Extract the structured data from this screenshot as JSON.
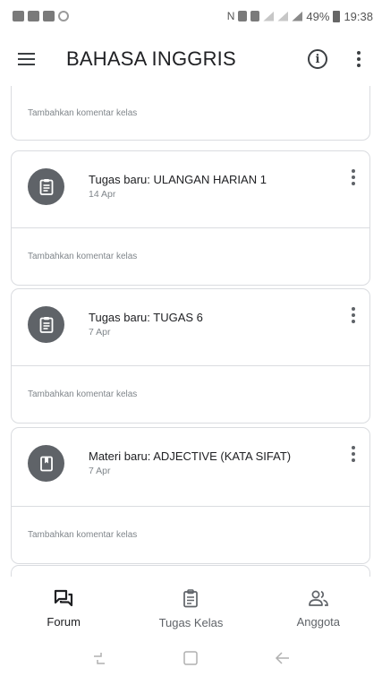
{
  "status_bar": {
    "battery": "49%",
    "time": "19:38"
  },
  "app_bar": {
    "title": "BAHASA INGGRIS",
    "info_icon": "info-icon",
    "more_icon": "more-vert-icon",
    "menu_icon": "menu-icon"
  },
  "stream": {
    "top_card": {
      "comment_placeholder": "Tambahkan komentar kelas"
    },
    "posts": [
      {
        "icon": "assignment-icon",
        "title": "Tugas baru: ULANGAN HARIAN 1",
        "date": "14 Apr",
        "comment_placeholder": "Tambahkan komentar kelas"
      },
      {
        "icon": "assignment-icon",
        "title": "Tugas baru: TUGAS 6",
        "date": "7 Apr",
        "comment_placeholder": "Tambahkan komentar kelas"
      },
      {
        "icon": "material-icon",
        "title": "Materi baru: ADJECTIVE (KATA SIFAT)",
        "date": "7 Apr",
        "comment_placeholder": "Tambahkan komentar kelas"
      }
    ]
  },
  "bottom_nav": {
    "items": [
      {
        "label": "Forum",
        "icon": "forum-icon",
        "active": true
      },
      {
        "label": "Tugas Kelas",
        "icon": "classwork-icon",
        "active": false
      },
      {
        "label": "Anggota",
        "icon": "people-icon",
        "active": false
      }
    ]
  },
  "system_nav": {
    "recent_icon": "recent-apps-icon",
    "home_icon": "home-icon",
    "back_icon": "back-icon"
  },
  "colors": {
    "icon_circle": "#5f6368",
    "divider": "#dadce0",
    "text_primary": "#202124",
    "text_secondary": "#80868b"
  }
}
